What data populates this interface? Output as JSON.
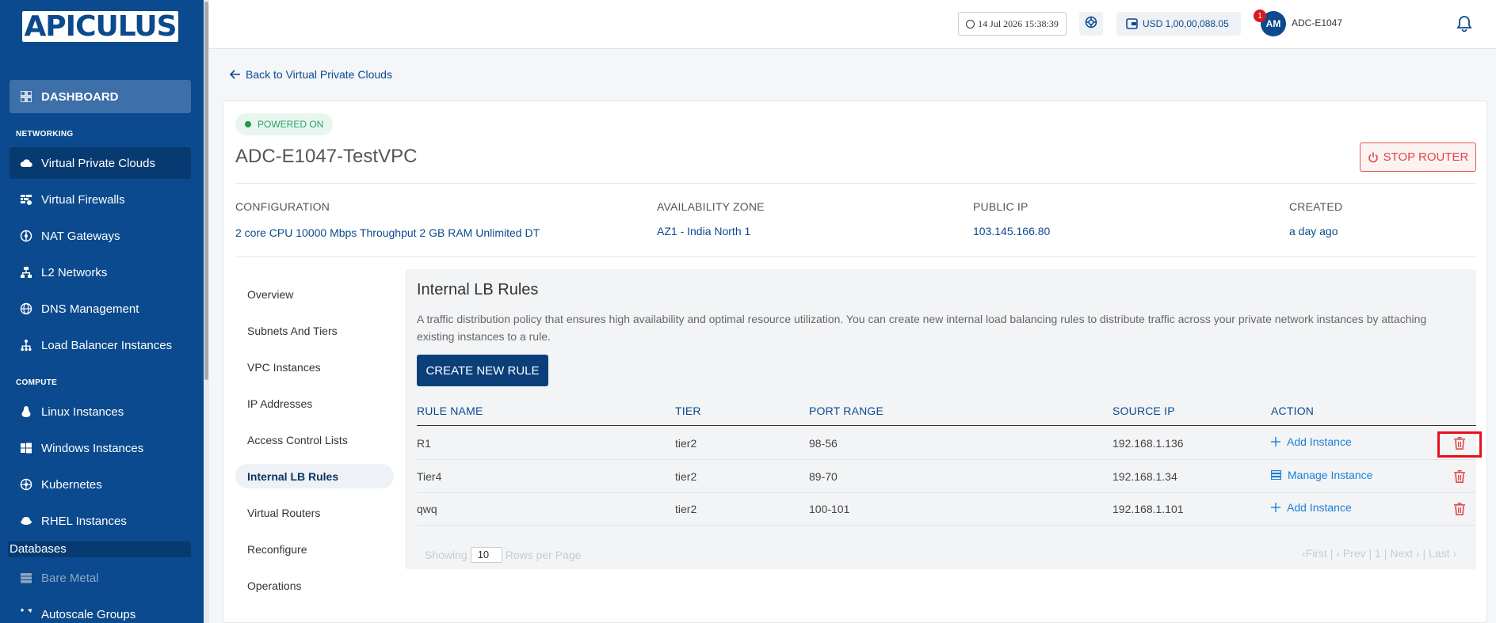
{
  "sidebar": {
    "logo": "APICULUS",
    "dashboard": "DASHBOARD",
    "sections": {
      "networking": "NETWORKING",
      "compute": "COMPUTE",
      "databases": "Databases"
    },
    "networking_items": [
      {
        "label": "Virtual Private Clouds",
        "icon": "cloud-icon"
      },
      {
        "label": "Virtual Firewalls",
        "icon": "firewall-icon"
      },
      {
        "label": "NAT Gateways",
        "icon": "nat-icon"
      },
      {
        "label": "L2 Networks",
        "icon": "network-icon"
      },
      {
        "label": "DNS Management",
        "icon": "globe-icon"
      },
      {
        "label": "Load Balancer Instances",
        "icon": "load-balancer-icon"
      }
    ],
    "compute_items": [
      {
        "label": "Linux Instances",
        "icon": "linux-icon"
      },
      {
        "label": "Windows Instances",
        "icon": "windows-icon"
      },
      {
        "label": "Kubernetes",
        "icon": "kubernetes-icon"
      },
      {
        "label": "RHEL Instances",
        "icon": "rhel-icon"
      }
    ],
    "other_items": [
      {
        "label": "Bare Metal",
        "icon": "server-icon"
      },
      {
        "label": "Autoscale Groups",
        "icon": "autoscale-icon"
      }
    ]
  },
  "header": {
    "datetime": "14 Jul 2026 15:38:39",
    "balance": "USD 1,00,00,088.05",
    "avatar_initials": "AM",
    "user": "ADC-E1047",
    "notification_count": "1"
  },
  "page": {
    "back_link": "Back to Virtual Private Clouds",
    "status": "POWERED ON",
    "title": "ADC-E1047-TestVPC",
    "stop_button": "STOP ROUTER",
    "info": {
      "configuration_label": "CONFIGURATION",
      "configuration": "2 core CPU 10000 Mbps Throughput 2 GB RAM Unlimited DT",
      "zone_label": "AVAILABILITY ZONE",
      "zone": "AZ1 - India North 1",
      "ip_label": "PUBLIC IP",
      "ip": "103.145.166.80",
      "created_label": "CREATED",
      "created": "a day ago"
    },
    "subnav": [
      "Overview",
      "Subnets And Tiers",
      "VPC Instances",
      "IP Addresses",
      "Access Control Lists",
      "Internal LB Rules",
      "Virtual Routers",
      "Reconfigure",
      "Operations"
    ],
    "active_subnav": "Internal LB Rules"
  },
  "panel": {
    "title": "Internal LB Rules",
    "description": "A traffic distribution policy that ensures high availability and optimal resource utilization. You can create new internal load balancing rules to distribute traffic across your private network instances by attaching existing instances to a rule.",
    "create_button": "CREATE NEW RULE",
    "columns": [
      "RULE NAME",
      "TIER",
      "PORT RANGE",
      "SOURCE IP",
      "ACTION"
    ],
    "rows": [
      {
        "name": "R1",
        "tier": "tier2",
        "port_range": "98-56",
        "source_ip": "192.168.1.136",
        "action": "Add Instance",
        "action_icon": "plus-icon"
      },
      {
        "name": "Tier4",
        "tier": "tier2",
        "port_range": "89-70",
        "source_ip": "192.168.1.34",
        "action": "Manage Instance",
        "action_icon": "list-icon"
      },
      {
        "name": "qwq",
        "tier": "tier2",
        "port_range": "100-101",
        "source_ip": "192.168.1.101",
        "action": "Add Instance",
        "action_icon": "plus-icon"
      }
    ],
    "pagination": {
      "showing": "Showing",
      "rows_per_page_value": "10",
      "rows_per_page": "Rows per Page",
      "nav": "‹First | ‹ Prev | 1 | Next › | Last ›"
    }
  },
  "colors": {
    "sidebar": "#0b4a8e",
    "accent": "#0b3f7a",
    "danger": "#e04848",
    "success": "#1c9c52"
  }
}
